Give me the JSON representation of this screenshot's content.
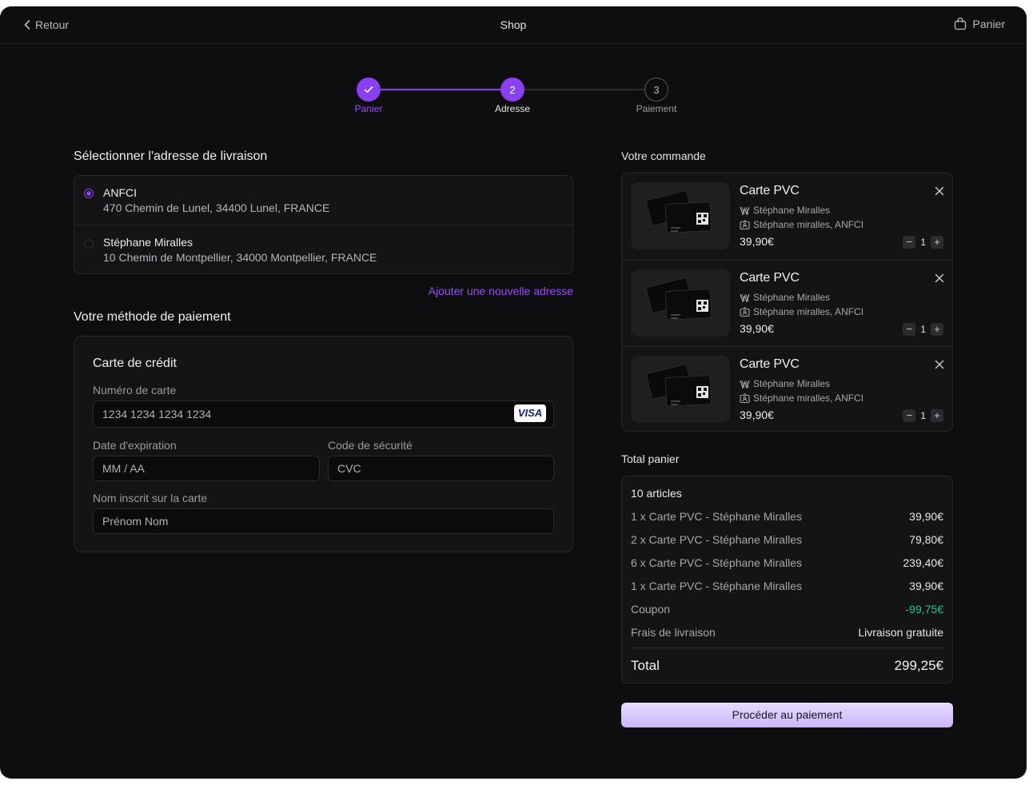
{
  "topbar": {
    "back_label": "Retour",
    "title": "Shop",
    "cart_label": "Panier"
  },
  "stepper": {
    "steps": [
      {
        "number": "",
        "label": "Panier",
        "state": "done"
      },
      {
        "number": "2",
        "label": "Adresse",
        "state": "active"
      },
      {
        "number": "3",
        "label": "Paiement",
        "state": "todo"
      }
    ],
    "accent": "#8b3ff2"
  },
  "address": {
    "heading": "Sélectionner l'adresse de livraison",
    "items": [
      {
        "name": "ANFCI",
        "line": "470 Chemin de Lunel, 34400 Lunel, FRANCE",
        "selected": true
      },
      {
        "name": "Stéphane Miralles",
        "line": "10 Chemin de Montpellier, 34000 Montpellier, FRANCE",
        "selected": false
      }
    ],
    "add_link": "Ajouter une nouvelle adresse"
  },
  "payment": {
    "heading": "Votre méthode de paiement",
    "card_title": "Carte de crédit",
    "card_number_label": "Numéro de carte",
    "card_number_placeholder": "1234 1234 1234 1234",
    "card_brand": "VISA",
    "expiry_label": "Date d'expiration",
    "expiry_placeholder": "MM / AA",
    "cvc_label": "Code de sécurité",
    "cvc_placeholder": "CVC",
    "name_label": "Nom inscrit sur la carte",
    "name_placeholder": "Prénom Nom"
  },
  "order": {
    "heading": "Votre commande",
    "items": [
      {
        "name": "Carte PVC",
        "owner": "Stéphane Miralles",
        "company": "Stéphane miralles, ANFCI",
        "price": "39,90€",
        "qty": "1"
      },
      {
        "name": "Carte PVC",
        "owner": "Stéphane Miralles",
        "company": "Stéphane miralles, ANFCI",
        "price": "39,90€",
        "qty": "1"
      },
      {
        "name": "Carte PVC",
        "owner": "Stéphane Miralles",
        "company": "Stéphane miralles, ANFCI",
        "price": "39,90€",
        "qty": "1"
      }
    ]
  },
  "totals": {
    "heading": "Total panier",
    "count": "10 articles",
    "lines": [
      {
        "label": "1 x Carte PVC - Stéphane Miralles",
        "value": "39,90€"
      },
      {
        "label": "2 x Carte PVC - Stéphane Miralles",
        "value": "79,80€"
      },
      {
        "label": "6 x Carte PVC - Stéphane Miralles",
        "value": "239,40€"
      },
      {
        "label": "1 x Carte PVC - Stéphane Miralles",
        "value": "39,90€"
      }
    ],
    "coupon_label": "Coupon",
    "coupon_value": "-99,75€",
    "shipping_label": "Frais de livraison",
    "shipping_value": "Livraison gratuite",
    "total_label": "Total",
    "total_value": "299,25€",
    "coupon_color": "#2fc48a"
  },
  "cta_label": "Procéder au paiement"
}
